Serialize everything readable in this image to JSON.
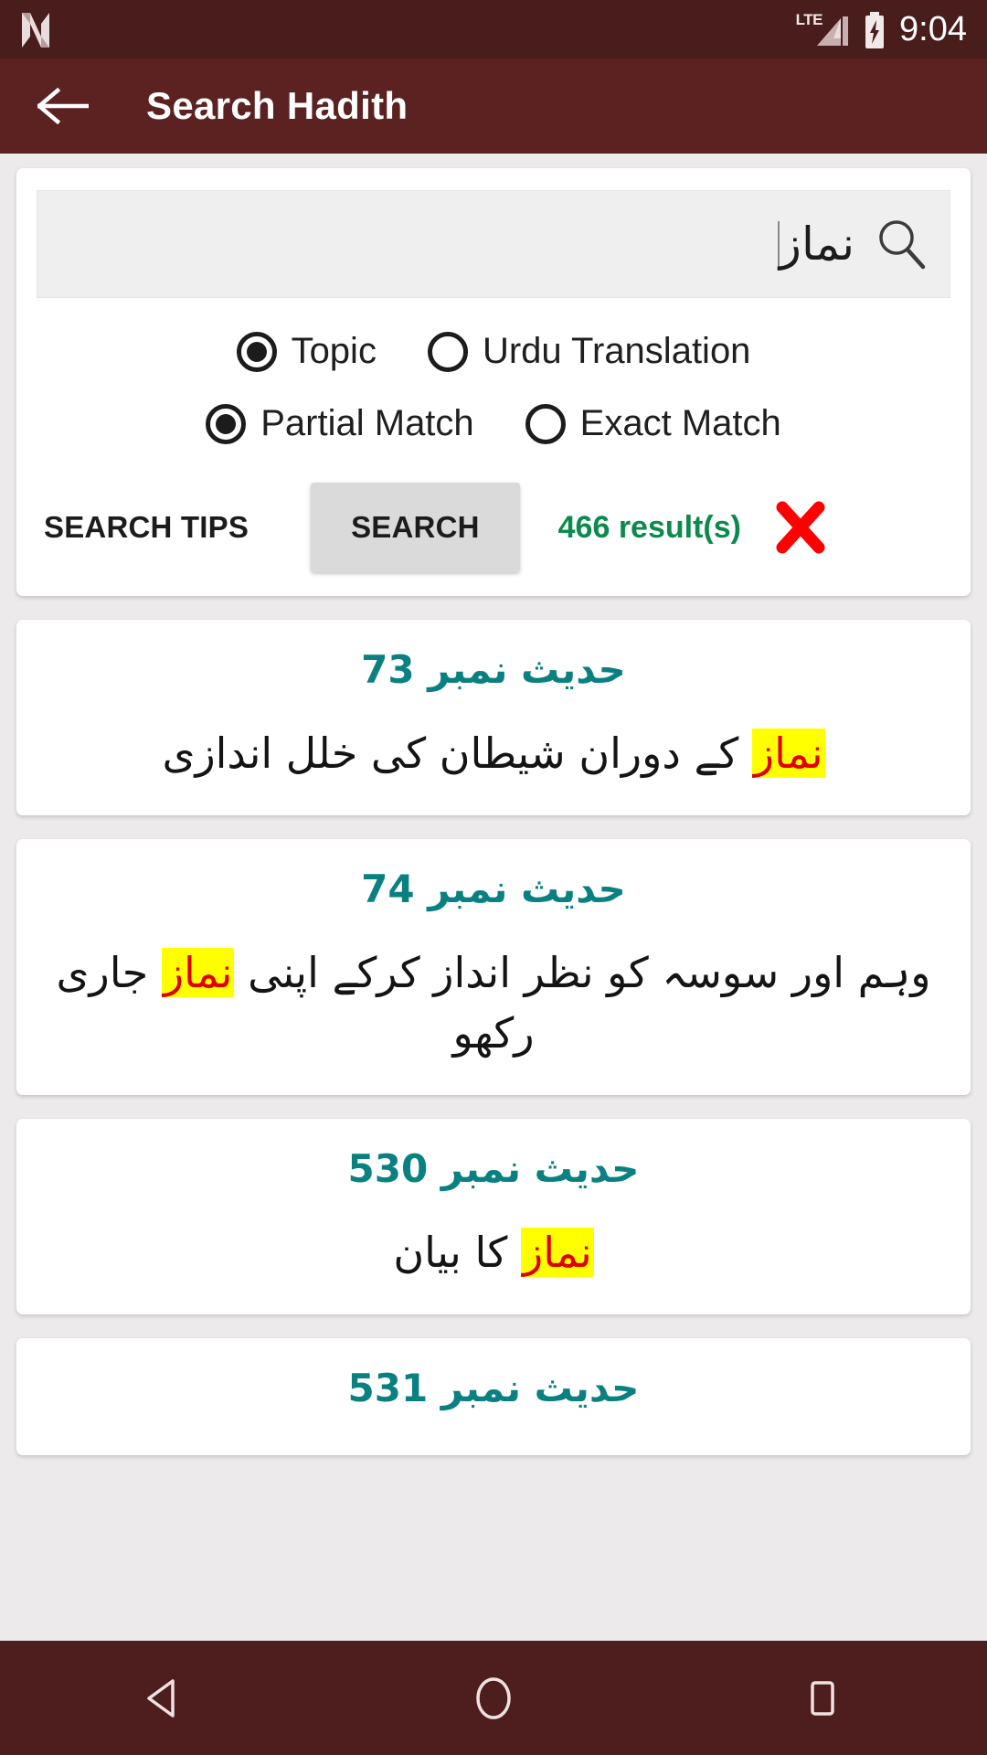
{
  "status_bar": {
    "notification_icon": "android-n-logo-icon",
    "network_label": "LTE",
    "signal_icon": "signal-bars-icon",
    "battery_icon": "battery-charging-icon",
    "time": "9:04"
  },
  "app_bar": {
    "back_icon": "back-arrow-icon",
    "title": "Search Hadith"
  },
  "search_panel": {
    "input": {
      "value": "نماز",
      "placeholder": ""
    },
    "search_icon": "magnifier-icon",
    "scope_options": [
      {
        "label": "Topic",
        "selected": true
      },
      {
        "label": "Urdu Translation",
        "selected": false
      }
    ],
    "match_options": [
      {
        "label": "Partial Match",
        "selected": true
      },
      {
        "label": "Exact Match",
        "selected": false
      }
    ],
    "tips_label": "SEARCH TIPS",
    "search_label": "SEARCH",
    "result_count": "466 result(s)",
    "clear_icon": "red-cross-clear-icon",
    "result_count_color": "#0c8a4d",
    "clear_icon_color": "#ff0000"
  },
  "results": [
    {
      "number": "حدیث نمبر 73",
      "text_before": "",
      "highlight": "نماز",
      "text_after": " کے دوران شیطان کی خلل اندازی"
    },
    {
      "number": "حدیث نمبر 74",
      "text_before": "وہم اور سوسہ کو نظر انداز کرکے اپنی ",
      "highlight": "نماز",
      "text_after": " جاری رکھو"
    },
    {
      "number": "حدیث نمبر 530",
      "text_before": "",
      "highlight": "نماز",
      "text_after": " کا بیان"
    },
    {
      "number": "حدیث نمبر 531",
      "text_before": "",
      "highlight": "",
      "text_after": ""
    }
  ],
  "nav_bar": {
    "back_icon": "nav-back-triangle-icon",
    "home_icon": "nav-home-circle-icon",
    "recents_icon": "nav-recents-square-icon"
  },
  "theme": {
    "status_bar_bg": "#4a1d1d",
    "app_bar_bg": "#5c2222",
    "page_bg": "#eceaea",
    "accent_teal": "#0a8080",
    "highlight_bg": "#ffff00",
    "highlight_fg": "#e00000"
  }
}
